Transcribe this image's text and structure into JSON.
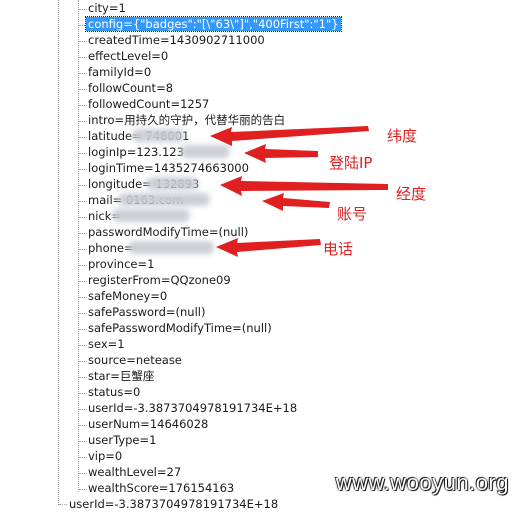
{
  "tree": {
    "nodes": [
      "city=1",
      "config={\"badges\":\"[\\\"63\\\"]\",\"400First\":\"1\"}",
      "createdTime=1430902711000",
      "effectLevel=0",
      "familyId=0",
      "followCount=8",
      "followedCount=1257",
      "intro=用持久的守护，代替华丽的告白",
      "latitude=   746001",
      "loginIp=123.123",
      "loginTime=1435274663000",
      "longitude=   132893",
      "mail=              0163.com",
      "nick=",
      "passwordModifyTime=(null)",
      "phone=",
      "province=1",
      "registerFrom=QQzone09",
      "safeMoney=0",
      "safePassword=(null)",
      "safePasswordModifyTime=(null)",
      "sex=1",
      "source=netease",
      "star=巨蟹座",
      "status=0",
      "userId=-3.3873704978191734E+18",
      "userNum=14646028",
      "userType=1",
      "vip=0",
      "wealthLevel=27",
      "wealthScore=176154163"
    ],
    "parent_node": "userId=-3.3873704978191734E+18"
  },
  "annotations": {
    "latitude": "纬度",
    "login_ip": "登陆IP",
    "longitude": "经度",
    "account": "账号",
    "phone": "电话"
  },
  "colors": {
    "annotation": "#e02020",
    "selection": "#3399ff"
  },
  "watermark": "www.wooyun.org"
}
